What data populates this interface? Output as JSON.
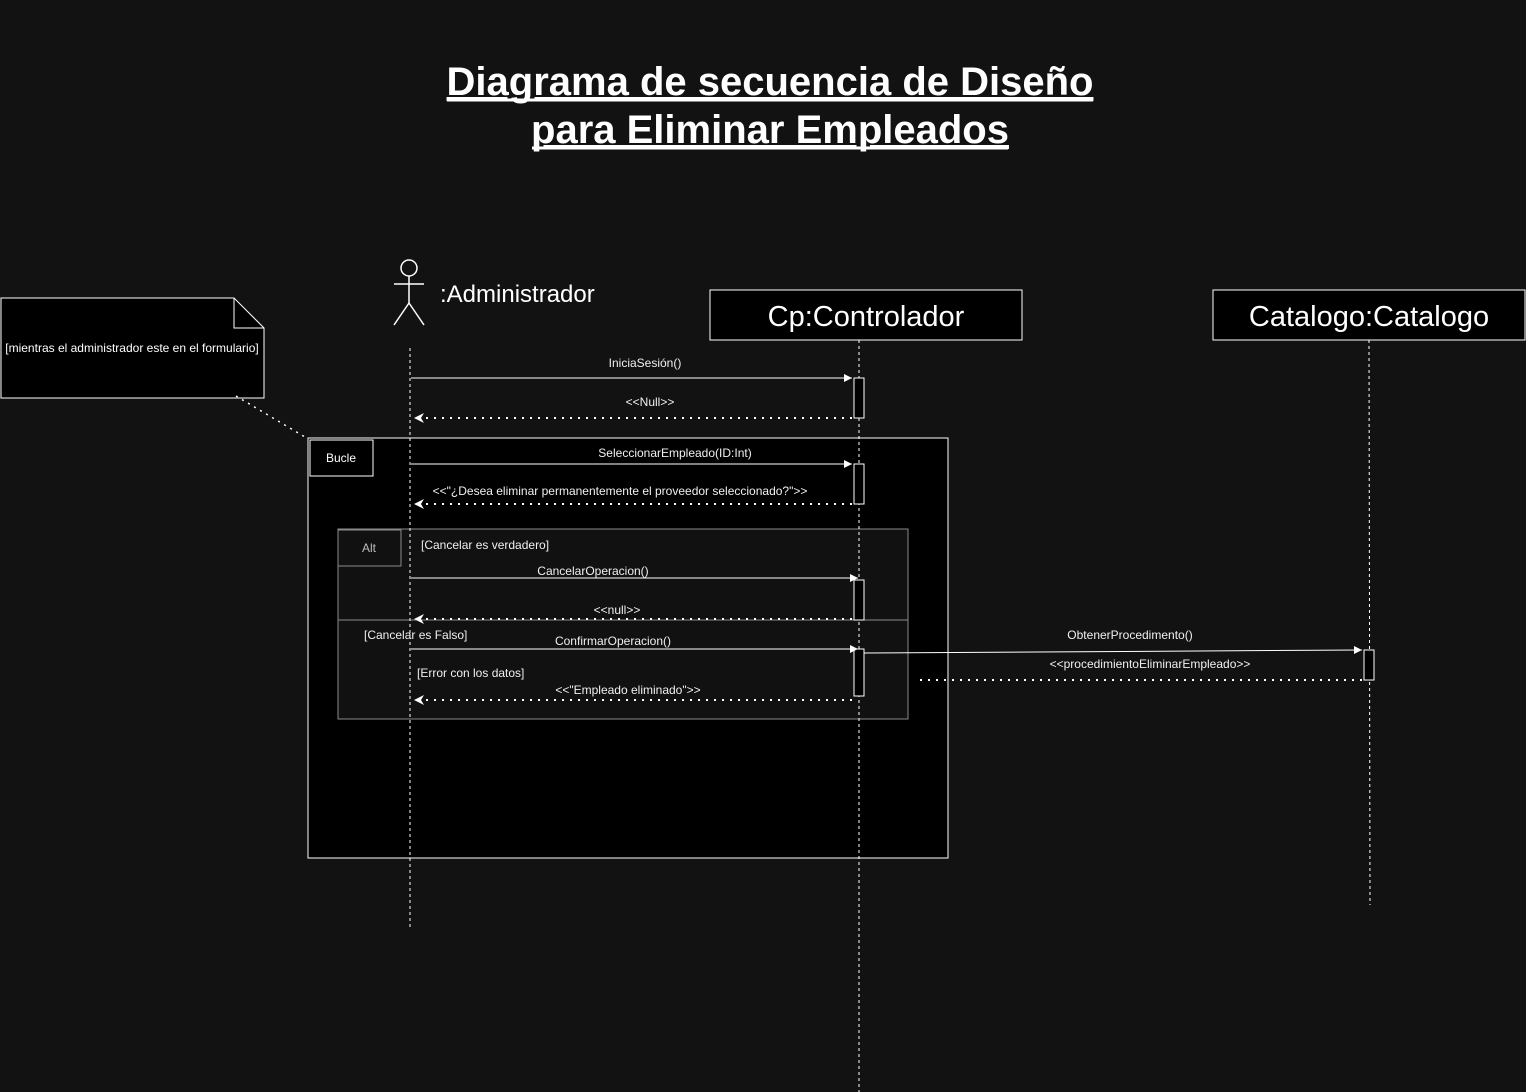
{
  "diagram": {
    "title_line1": "Diagrama de secuencia de Diseño",
    "title_line2": "para Eliminar Empleados",
    "note": "[mientras el administrador este en el formulario]",
    "actor": ":Administrador",
    "participants": {
      "controller": "Cp:Controlador",
      "catalog": "Catalogo:Catalogo"
    },
    "frames": {
      "loop": "Bucle",
      "alt": "Alt"
    },
    "guards": {
      "cancel_true": "[Cancelar es verdadero]",
      "cancel_false": "[Cancelar es Falso]",
      "data_error": "[Error con los datos]"
    },
    "messages": {
      "m1": "IniciaSesión()",
      "m2": "<<Null>>",
      "m3": "SeleccionarEmpleado(ID:Int)",
      "m4": "<<\"¿Desea eliminar permanentemente el proveedor seleccionado?\">>",
      "m5": "CancelarOperacion()",
      "m6": "<<null>>",
      "m7": "ConfirmarOperacion()",
      "m8": "ObtenerProcedimento()",
      "m9": "<<procedimientoEliminarEmpleado>>",
      "m10": "<<\"Empleado eliminado\">>"
    },
    "colors": {
      "background": "#121212",
      "lines": "#ffffff",
      "frame_fill": "#000000",
      "alt_frame_border": "#8a8a8a"
    }
  }
}
